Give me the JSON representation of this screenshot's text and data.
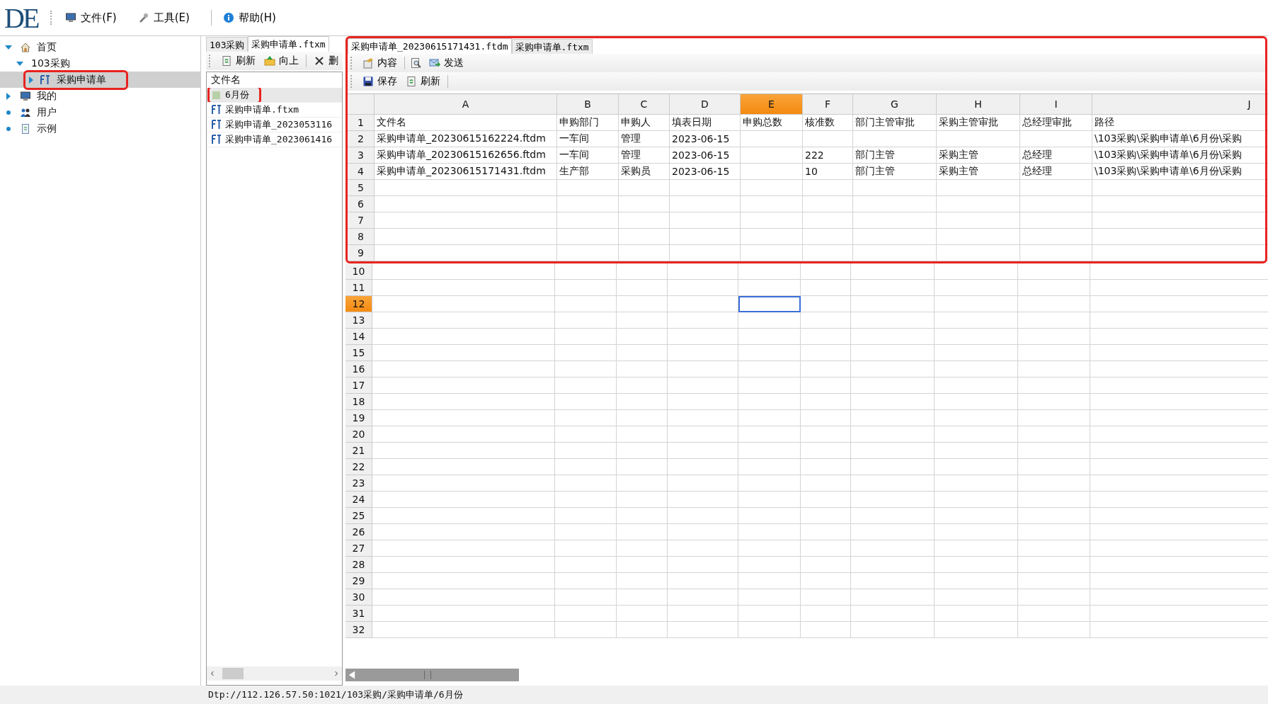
{
  "logo": "DE",
  "menu": [
    {
      "label": "文件(F)",
      "kind": "computer"
    },
    {
      "label": "工具(E)",
      "kind": "wrench"
    },
    {
      "label": "帮助(H)",
      "kind": "info"
    }
  ],
  "sidebar": {
    "tree": [
      {
        "label": "首页",
        "kind": "home",
        "expanded": true,
        "selected": false,
        "highlighted": false,
        "children": [
          {
            "label": "103采购",
            "expanded": true,
            "selected": false,
            "highlighted": false,
            "children": [
              {
                "label": "采购申请单",
                "kind": "form",
                "expanded": false,
                "selected": true,
                "highlighted": true
              }
            ]
          }
        ]
      },
      {
        "label": "我的",
        "kind": "computer",
        "expanded": false,
        "selected": false,
        "highlighted": false
      },
      {
        "label": "用户",
        "kind": "users",
        "selected": false,
        "highlighted": false
      },
      {
        "label": "示例",
        "kind": "document",
        "selected": false,
        "highlighted": false
      }
    ]
  },
  "file_browser": {
    "tabs": [
      {
        "label": "103采购",
        "selected": false
      },
      {
        "label": "采购申请单.ftxm",
        "selected": true
      }
    ],
    "toolbar": [
      {
        "label": "刷新",
        "kind": "refresh"
      },
      {
        "label": "向上",
        "kind": "up"
      },
      {
        "kind": "separator"
      },
      {
        "label": "删",
        "kind": "delete"
      }
    ],
    "header": "文件名",
    "files": [
      {
        "name": "6月份",
        "kind": "folder",
        "selected": true,
        "highlighted": true
      },
      {
        "name": "采购申请单.ftxm",
        "kind": "form",
        "selected": false,
        "highlighted": false
      },
      {
        "name": "采购申请单_2023053116",
        "kind": "form",
        "selected": false,
        "highlighted": false
      },
      {
        "name": "采购申请单_2023061416",
        "kind": "form",
        "selected": false,
        "highlighted": false
      }
    ]
  },
  "editor": {
    "highlighted": true,
    "tabs": [
      {
        "label": "采购申请单_20230615171431.ftdm",
        "selected": true
      },
      {
        "label": "采购申请单.ftxm",
        "selected": false
      }
    ],
    "toolbar": [
      {
        "label": "内容",
        "kind": "content"
      },
      {
        "kind": "separator"
      },
      {
        "kind": "preview"
      },
      {
        "label": "发送",
        "kind": "send"
      }
    ],
    "toolbar_2": [
      {
        "label": "保存",
        "kind": "save"
      },
      {
        "label": "刷新",
        "kind": "refresh"
      },
      {
        "kind": "separator"
      }
    ],
    "sheet": {
      "columns": [
        {
          "label": "A",
          "selected": false
        },
        {
          "label": "B",
          "selected": false
        },
        {
          "label": "C",
          "selected": false
        },
        {
          "label": "D",
          "selected": false
        },
        {
          "label": "E",
          "selected": true
        },
        {
          "label": "F",
          "selected": false
        },
        {
          "label": "G",
          "selected": false
        },
        {
          "label": "H",
          "selected": false
        },
        {
          "label": "I",
          "selected": false
        },
        {
          "label": "J",
          "selected": false
        }
      ],
      "rows": [
        {
          "number": "1",
          "selected": false,
          "highlighted": true,
          "cells": [
            "文件名",
            "申购部门",
            "申购人",
            "填表日期",
            "申购总数",
            "核准数",
            "部门主管审批",
            "采购主管审批",
            "总经理审批",
            "路径"
          ]
        },
        {
          "number": "2",
          "selected": false,
          "highlighted": true,
          "cells": [
            "采购申请单_20230615162224.ftdm",
            "一车间",
            "管理",
            "2023-06-15",
            null,
            null,
            null,
            null,
            null,
            "\\103采购\\采购申请单\\6月份\\采购"
          ]
        },
        {
          "number": "3",
          "selected": false,
          "highlighted": true,
          "cells": [
            "采购申请单_20230615162656.ftdm",
            "一车间",
            "管理",
            "2023-06-15",
            null,
            "222",
            "部门主管",
            "采购主管",
            "总经理",
            "\\103采购\\采购申请单\\6月份\\采购"
          ]
        },
        {
          "number": "4",
          "selected": false,
          "highlighted": true,
          "cells": [
            "采购申请单_20230615171431.ftdm",
            "生产部",
            "采购员",
            "2023-06-15",
            null,
            "10",
            "部门主管",
            "采购主管",
            "总经理",
            "\\103采购\\采购申请单\\6月份\\采购"
          ]
        },
        {
          "number": "5",
          "selected": false,
          "highlighted": true
        },
        {
          "number": "6",
          "selected": false,
          "highlighted": true
        },
        {
          "number": "7",
          "selected": false,
          "highlighted": true
        },
        {
          "number": "8",
          "selected": false,
          "highlighted": true
        },
        {
          "number": "9",
          "selected": false,
          "highlighted": true
        },
        {
          "number": "10",
          "selected": false,
          "highlighted": false
        },
        {
          "number": "11",
          "selected": false,
          "highlighted": false
        },
        {
          "number": "12",
          "selected": true,
          "highlighted": false
        },
        {
          "number": "13",
          "selected": false,
          "highlighted": false
        },
        {
          "number": "14",
          "selected": false,
          "highlighted": false
        },
        {
          "number": "15",
          "selected": false,
          "highlighted": false
        },
        {
          "number": "16",
          "selected": false,
          "highlighted": false
        },
        {
          "number": "17",
          "selected": false,
          "highlighted": false
        },
        {
          "number": "18",
          "selected": false,
          "highlighted": false
        },
        {
          "number": "19",
          "selected": false,
          "highlighted": false
        },
        {
          "number": "20",
          "selected": false,
          "highlighted": false
        },
        {
          "number": "21",
          "selected": false,
          "highlighted": false
        },
        {
          "number": "22",
          "selected": false,
          "highlighted": false
        },
        {
          "number": "23",
          "selected": false,
          "highlighted": false
        },
        {
          "number": "24",
          "selected": false,
          "highlighted": false
        },
        {
          "number": "25",
          "selected": false,
          "highlighted": false
        },
        {
          "number": "26",
          "selected": false,
          "highlighted": false
        },
        {
          "number": "27",
          "selected": false,
          "highlighted": false
        },
        {
          "number": "28",
          "selected": false,
          "highlighted": false
        },
        {
          "number": "29",
          "selected": false,
          "highlighted": false
        },
        {
          "number": "30",
          "selected": false,
          "highlighted": false
        },
        {
          "number": "31",
          "selected": false,
          "highlighted": false
        },
        {
          "number": "32",
          "selected": false,
          "highlighted": false
        }
      ]
    }
  },
  "status_bar": "Dtp://112.126.57.50:1021/103采购/采购申请单/6月份"
}
